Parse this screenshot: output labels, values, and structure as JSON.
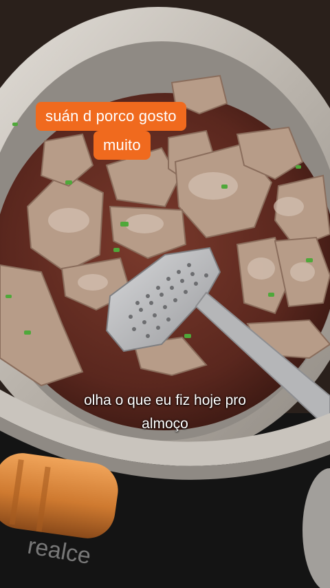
{
  "caption": {
    "line1": "suán d porco gosto",
    "line2": "muito",
    "background_color": "#f06a1e",
    "text_color": "#ffffff"
  },
  "subtitle": {
    "line1": "olha o que eu fiz hoje pro",
    "line2": "almoço",
    "text_color": "#ffffff"
  },
  "stove_brand": "realce",
  "scene": {
    "pot_color": "#c9c4bd",
    "stew_color": "#6a2f25",
    "meat_color": "#b79c88",
    "herb_color": "#4fa83a",
    "spatula_color": "#b8b9bb",
    "handle_color": "#d8873a"
  }
}
